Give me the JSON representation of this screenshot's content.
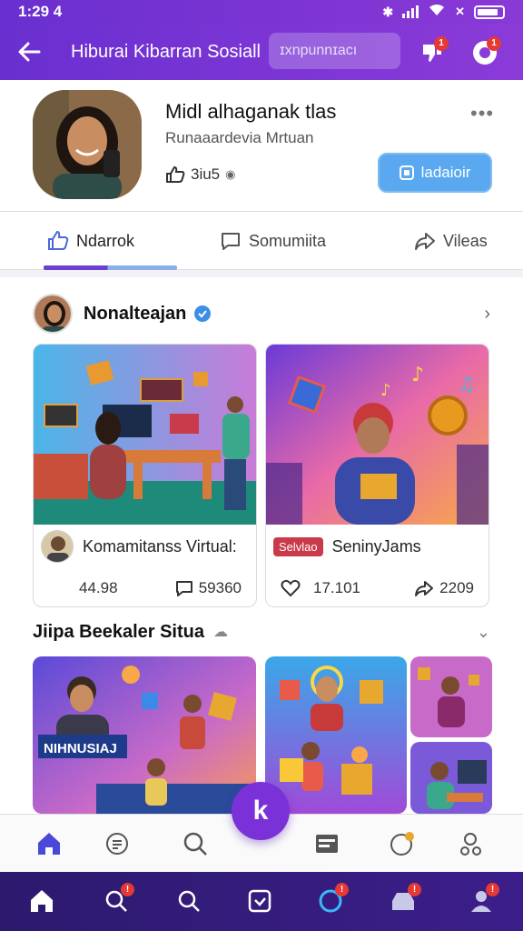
{
  "status_bar": {
    "time": "1:29 4"
  },
  "header": {
    "title": "Hiburai Kibarran Sosiall",
    "search_placeholder": "ɪxnpunnɪacı",
    "notification_badge": "1",
    "messages_badge": "1"
  },
  "profile": {
    "name": "Midl alhaganak tlas",
    "subtitle": "Runaaardevia Mrtuan",
    "stat": "3iu5",
    "follow_label": "ladaioir"
  },
  "tabs": [
    {
      "label": "Ndarrok",
      "icon": "thumbs-up-icon",
      "active": true
    },
    {
      "label": "Somumiita",
      "icon": "comment-icon",
      "active": false
    },
    {
      "label": "Vileas",
      "icon": "share-icon",
      "active": false
    }
  ],
  "section1": {
    "title": "Nonalteajan",
    "cards": [
      {
        "title": "Komamitanss Virtual:",
        "views": "44.98",
        "comments": "59360"
      },
      {
        "title": "SeninyJams",
        "tag": "Selvlao",
        "likes": "17.101",
        "shares": "2209"
      }
    ]
  },
  "section2": {
    "title": "Jiipa Beekaler Situa",
    "banner_text": "NIHNUSIAJ"
  },
  "fab_label": "k",
  "bottom_nav": [
    "home-icon",
    "chat-icon",
    "search-icon",
    "inbox-icon",
    "gift-icon",
    "people-icon"
  ],
  "sys_nav": {
    "items": [
      "home-icon",
      "search-icon",
      "search-icon",
      "check-box-icon",
      "circle-icon",
      "inbox-icon",
      "person-icon"
    ],
    "badges": [
      "!",
      "!",
      "!",
      "!"
    ]
  },
  "colors": {
    "primary": "#7a32d8",
    "accent_blue": "#5aa8ef",
    "badge_red": "#e53935"
  }
}
